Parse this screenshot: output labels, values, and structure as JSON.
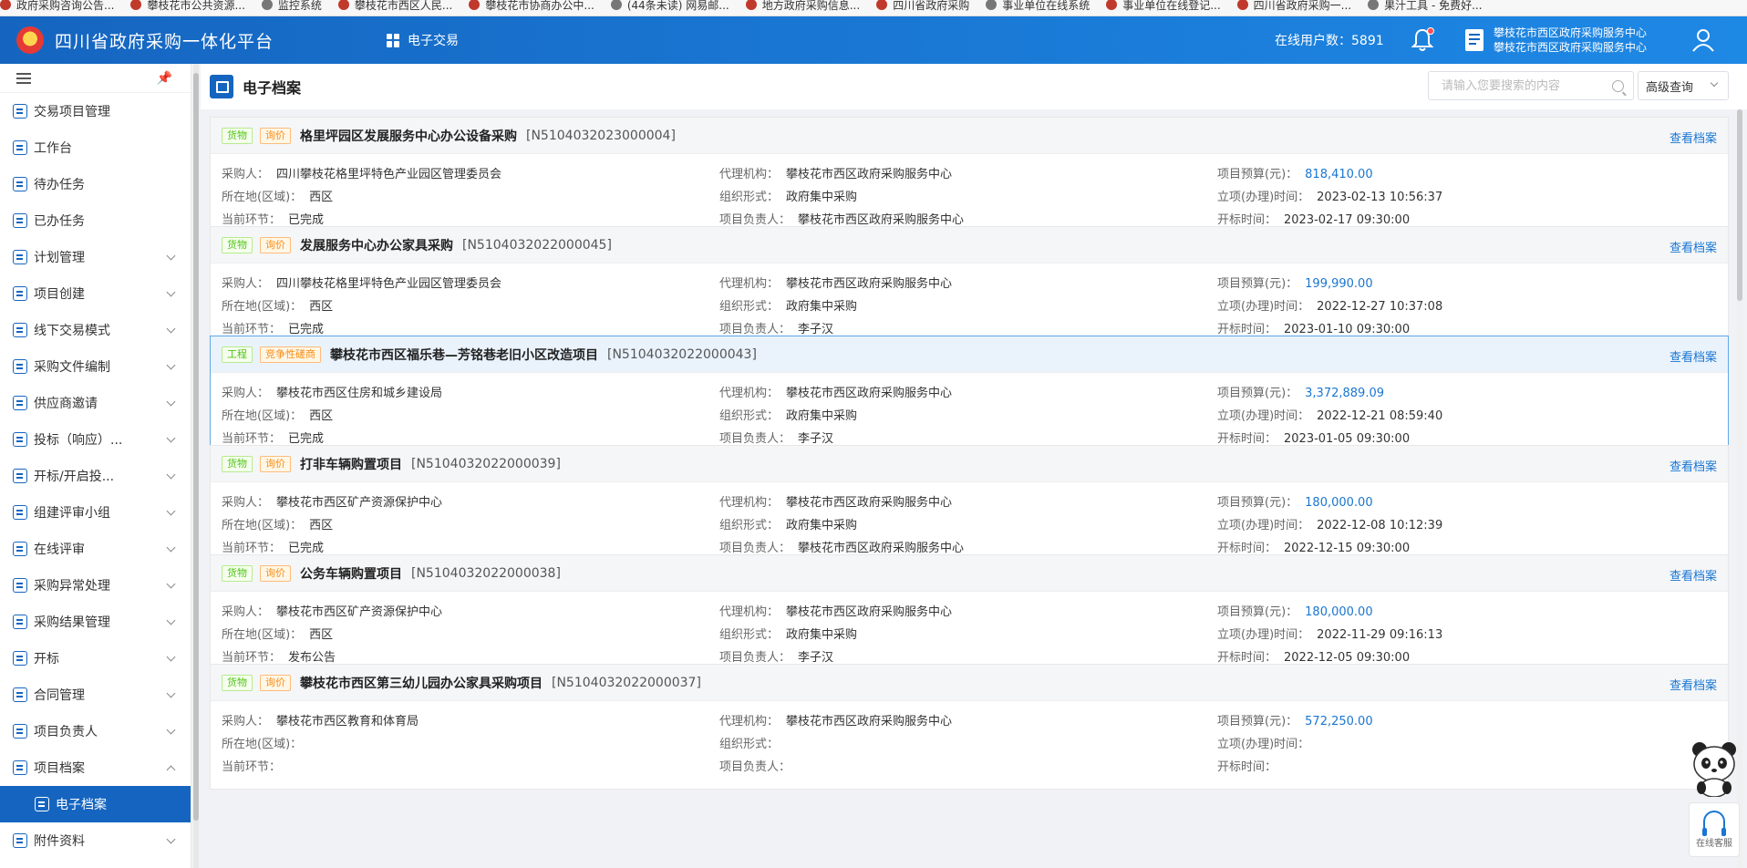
{
  "bookmarks": [
    "政府采购咨询公告...",
    "攀枝花市公共资源...",
    "监控系统",
    "攀枝花市西区人民...",
    "攀枝花市协商办公中...",
    "(44条未读) 网易邮...",
    "地方政府采购信息...",
    "四川省政府采购",
    "事业单位在线系统",
    "事业单位在线登记...",
    "四川省政府采购一...",
    "果汁工具 - 免费好..."
  ],
  "header": {
    "title": "四川省政府采购一体化平台",
    "module": "电子交易",
    "online_label": "在线用户数：",
    "online_count": "5891",
    "org_line1": "攀枝花市西区政府采购服务中心",
    "org_line2": "攀枝花市西区政府采购服务中心"
  },
  "sidebar": {
    "items": [
      {
        "label": "交易项目管理",
        "has_chevron": false
      },
      {
        "label": "工作台",
        "has_chevron": false
      },
      {
        "label": "待办任务",
        "has_chevron": false
      },
      {
        "label": "已办任务",
        "has_chevron": false
      },
      {
        "label": "计划管理",
        "has_chevron": true
      },
      {
        "label": "项目创建",
        "has_chevron": true
      },
      {
        "label": "线下交易模式",
        "has_chevron": true
      },
      {
        "label": "采购文件编制",
        "has_chevron": true
      },
      {
        "label": "供应商邀请",
        "has_chevron": true
      },
      {
        "label": "投标（响应）...",
        "has_chevron": true
      },
      {
        "label": "开标/开启投...",
        "has_chevron": true
      },
      {
        "label": "组建评审小组",
        "has_chevron": true
      },
      {
        "label": "在线评审",
        "has_chevron": true
      },
      {
        "label": "采购异常处理",
        "has_chevron": true
      },
      {
        "label": "采购结果管理",
        "has_chevron": true
      },
      {
        "label": "开标",
        "has_chevron": true
      },
      {
        "label": "合同管理",
        "has_chevron": true
      },
      {
        "label": "项目负责人",
        "has_chevron": true
      },
      {
        "label": "项目档案",
        "has_chevron": true,
        "expanded": true
      }
    ],
    "active_sub": "电子档案",
    "after": [
      {
        "label": "附件资料",
        "has_chevron": true
      }
    ]
  },
  "page": {
    "title": "电子档案",
    "search_placeholder": "请输入您要搜索的内容",
    "advanced_search": "高级查询"
  },
  "labels": {
    "purchaser": "采购人：",
    "agency": "代理机构：",
    "budget": "项目预算(元)：",
    "region": "所在地(区域)：",
    "org_form": "组织形式：",
    "setup_time": "立项(办理)时间：",
    "stage": "当前环节：",
    "manager": "项目负责人：",
    "open_time": "开标时间：",
    "view": "查看档案"
  },
  "projects": [
    {
      "type": "货物",
      "method": "询价",
      "title": "格里坪园区发展服务中心办公设备采购",
      "code": "[N5104032023000004]",
      "purchaser": "四川攀枝花格里坪特色产业园区管理委员会",
      "agency": "攀枝花市西区政府采购服务中心",
      "budget": "818,410.00",
      "region": "西区",
      "org_form": "政府集中采购",
      "setup_time": "2023-02-13 10:56:37",
      "stage": "已完成",
      "manager": "攀枝花市西区政府采购服务中心",
      "open_time": "2023-02-17 09:30:00"
    },
    {
      "type": "货物",
      "method": "询价",
      "title": "发展服务中心办公家具采购",
      "code": "[N5104032022000045]",
      "purchaser": "四川攀枝花格里坪特色产业园区管理委员会",
      "agency": "攀枝花市西区政府采购服务中心",
      "budget": "199,990.00",
      "region": "西区",
      "org_form": "政府集中采购",
      "setup_time": "2022-12-27 10:37:08",
      "stage": "已完成",
      "manager": "李子汉",
      "open_time": "2023-01-10 09:30:00"
    },
    {
      "type": "工程",
      "method": "竞争性磋商",
      "title": "攀枝花市西区福乐巷—芳铭巷老旧小区改造项目",
      "code": "[N5104032022000043]",
      "purchaser": "攀枝花市西区住房和城乡建设局",
      "agency": "攀枝花市西区政府采购服务中心",
      "budget": "3,372,889.09",
      "region": "西区",
      "org_form": "政府集中采购",
      "setup_time": "2022-12-21 08:59:40",
      "stage": "已完成",
      "manager": "李子汉",
      "open_time": "2023-01-05 09:30:00",
      "highlight": true
    },
    {
      "type": "货物",
      "method": "询价",
      "title": "打非车辆购置项目",
      "code": "[N5104032022000039]",
      "purchaser": "攀枝花市西区矿产资源保护中心",
      "agency": "攀枝花市西区政府采购服务中心",
      "budget": "180,000.00",
      "region": "西区",
      "org_form": "政府集中采购",
      "setup_time": "2022-12-08 10:12:39",
      "stage": "已完成",
      "manager": "攀枝花市西区政府采购服务中心",
      "open_time": "2022-12-15 09:30:00"
    },
    {
      "type": "货物",
      "method": "询价",
      "title": "公务车辆购置项目",
      "code": "[N5104032022000038]",
      "purchaser": "攀枝花市西区矿产资源保护中心",
      "agency": "攀枝花市西区政府采购服务中心",
      "budget": "180,000.00",
      "region": "西区",
      "org_form": "政府集中采购",
      "setup_time": "2022-11-29 09:16:13",
      "stage": "发布公告",
      "manager": "李子汉",
      "open_time": "2022-12-05 09:30:00"
    },
    {
      "type": "货物",
      "method": "询价",
      "title": "攀枝花市西区第三幼儿园办公家具采购项目",
      "code": "[N5104032022000037]",
      "purchaser": "攀枝花市西区教育和体育局",
      "agency": "攀枝花市西区政府采购服务中心",
      "budget": "572,250.00",
      "region": "",
      "org_form": "",
      "setup_time": "",
      "stage": "",
      "manager": "",
      "open_time": ""
    }
  ],
  "service": {
    "label": "在线客服"
  },
  "colors": {
    "primary": "#1565c0",
    "link": "#1976d2",
    "goods_tag": "#52c41a",
    "method_tag": "#fa8c16"
  }
}
